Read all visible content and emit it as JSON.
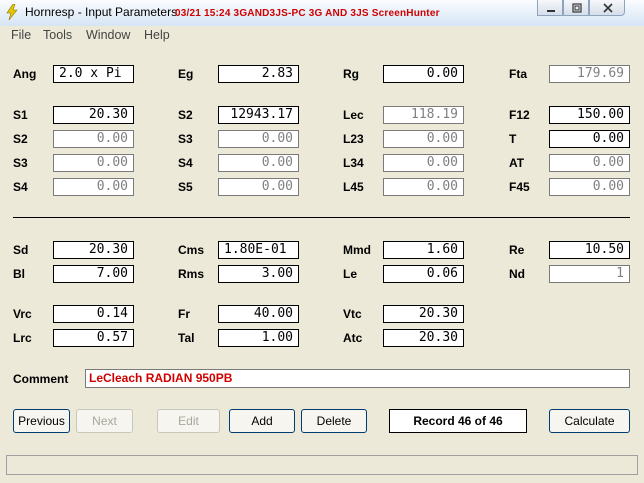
{
  "window": {
    "title": "Hornresp - Input Parameters",
    "overlay": "03/21  15:24  3GAND3JS-PC  3G AND 3JS  ScreenHunter"
  },
  "menu": [
    "File",
    "Tools",
    "Window",
    "Help"
  ],
  "fields": {
    "ang": {
      "label": "Ang",
      "value": "2.0 x Pi"
    },
    "eg": {
      "label": "Eg",
      "value": "2.83"
    },
    "rg": {
      "label": "Rg",
      "value": "0.00"
    },
    "fta": {
      "label": "Fta",
      "value": "179.69"
    },
    "s1": {
      "label": "S1",
      "value": "20.30"
    },
    "s2a": {
      "label": "S2",
      "value": "12943.17"
    },
    "lec": {
      "label": "Lec",
      "value": "118.19"
    },
    "f12": {
      "label": "F12",
      "value": "150.00"
    },
    "s2": {
      "label": "S2",
      "value": "0.00"
    },
    "s3a": {
      "label": "S3",
      "value": "0.00"
    },
    "l23": {
      "label": "L23",
      "value": "0.00"
    },
    "t": {
      "label": "T",
      "value": "0.00"
    },
    "s3": {
      "label": "S3",
      "value": "0.00"
    },
    "s4a": {
      "label": "S4",
      "value": "0.00"
    },
    "l34": {
      "label": "L34",
      "value": "0.00"
    },
    "at": {
      "label": "AT",
      "value": "0.00"
    },
    "s4": {
      "label": "S4",
      "value": "0.00"
    },
    "s5": {
      "label": "S5",
      "value": "0.00"
    },
    "l45": {
      "label": "L45",
      "value": "0.00"
    },
    "f45": {
      "label": "F45",
      "value": "0.00"
    },
    "sd": {
      "label": "Sd",
      "value": "20.30"
    },
    "cms": {
      "label": "Cms",
      "value": "1.80E-01"
    },
    "mmd": {
      "label": "Mmd",
      "value": "1.60"
    },
    "re": {
      "label": "Re",
      "value": "10.50"
    },
    "bl": {
      "label": "Bl",
      "value": "7.00"
    },
    "rms": {
      "label": "Rms",
      "value": "3.00"
    },
    "le": {
      "label": "Le",
      "value": "0.06"
    },
    "nd": {
      "label": "Nd",
      "value": "1"
    },
    "vrc": {
      "label": "Vrc",
      "value": "0.14"
    },
    "fr": {
      "label": "Fr",
      "value": "40.00"
    },
    "vtc": {
      "label": "Vtc",
      "value": "20.30"
    },
    "lrc": {
      "label": "Lrc",
      "value": "0.57"
    },
    "tal": {
      "label": "Tal",
      "value": "1.00"
    },
    "atc": {
      "label": "Atc",
      "value": "20.30"
    }
  },
  "comment": {
    "label": "Comment",
    "value": "LeCleach RADIAN 950PB"
  },
  "buttons": {
    "previous": "Previous",
    "next": "Next",
    "edit": "Edit",
    "add": "Add",
    "delete": "Delete",
    "calculate": "Calculate"
  },
  "record": "Record 46 of 46",
  "colors": {
    "overlay": "#d00000",
    "comment_text": "#d00000",
    "disabled_text": "#808080"
  }
}
